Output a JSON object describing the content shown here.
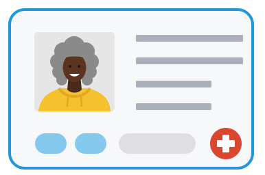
{
  "card": {
    "border_color": "#1f98dc",
    "background": "#f6f8fa"
  },
  "profile": {
    "avatar": {
      "icon": "person-portrait",
      "background": "#e6e6e6",
      "hair_color": "#8a8a8a",
      "skin_color": "#5b3420",
      "hoodie_color": "#f6c12e"
    },
    "text_placeholder_lines": 4,
    "line_color": "#a9b0b7"
  },
  "actions": {
    "tag_color": "#86c9ee",
    "field_color": "#dfdfe1",
    "add_button": {
      "icon": "plus-icon",
      "color": "#d9472e"
    }
  }
}
